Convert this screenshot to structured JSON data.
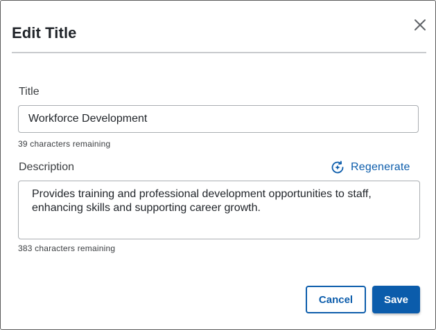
{
  "dialog": {
    "title": "Edit Title",
    "close_icon": "close-icon"
  },
  "fields": {
    "title": {
      "label": "Title",
      "value": "Workforce Development",
      "helper": "39 characters remaining"
    },
    "description": {
      "label": "Description",
      "value": "Provides training and professional development opportunities to staff, enhancing skills and supporting career growth.",
      "helper": "383 characters remaining",
      "regenerate_label": "Regenerate",
      "regenerate_icon": "sparkle-refresh-icon"
    }
  },
  "actions": {
    "cancel_label": "Cancel",
    "save_label": "Save"
  },
  "colors": {
    "accent": "#0b5cab",
    "text": "#1f2328",
    "border": "#a9adb1"
  }
}
